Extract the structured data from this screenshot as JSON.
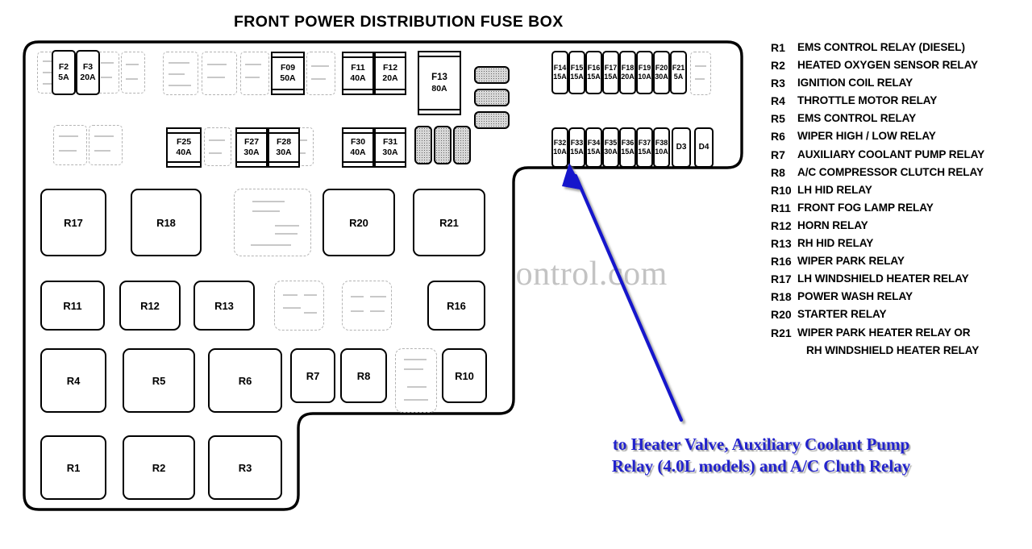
{
  "title": "FRONT POWER DISTRIBUTION FUSE BOX",
  "watermark": "JaguarClimateControl.com",
  "colors": {
    "annotation_blue": "#2222CC",
    "outline_black": "#000000",
    "watermark_grey": "#C3C3C3",
    "shaded_grey": "#D8D8D8"
  },
  "annotation": {
    "line1": "to Heater Valve, Auxiliary Coolant Pump",
    "line2": "Relay (4.0L models) and A/C Cluth Relay",
    "arrow_target": "F33 fuse"
  },
  "fuses": {
    "left_top": [
      {
        "id": "F2",
        "amp": "5A"
      },
      {
        "id": "F3",
        "amp": "20A"
      }
    ],
    "row1": [
      {
        "id": "F09",
        "amp": "50A"
      },
      {
        "id": "F11",
        "amp": "40A"
      },
      {
        "id": "F12",
        "amp": "20A"
      },
      {
        "id": "F13",
        "amp": "80A"
      }
    ],
    "row2": [
      {
        "id": "F25",
        "amp": "40A"
      },
      {
        "id": "F27",
        "amp": "30A"
      },
      {
        "id": "F28",
        "amp": "30A"
      },
      {
        "id": "F30",
        "amp": "40A"
      },
      {
        "id": "F31",
        "amp": "30A"
      }
    ],
    "right_top_strip": [
      {
        "id": "F14",
        "amp": "15A"
      },
      {
        "id": "F15",
        "amp": "15A"
      },
      {
        "id": "F16",
        "amp": "15A"
      },
      {
        "id": "F17",
        "amp": "15A"
      },
      {
        "id": "F18",
        "amp": "20A"
      },
      {
        "id": "F19",
        "amp": "10A"
      },
      {
        "id": "F20",
        "amp": "30A"
      },
      {
        "id": "F21",
        "amp": "5A"
      }
    ],
    "right_bottom_strip": [
      {
        "id": "F32",
        "amp": "10A"
      },
      {
        "id": "F33",
        "amp": "15A"
      },
      {
        "id": "F34",
        "amp": "15A"
      },
      {
        "id": "F35",
        "amp": "30A"
      },
      {
        "id": "F36",
        "amp": "15A"
      },
      {
        "id": "F37",
        "amp": "15A"
      },
      {
        "id": "F38",
        "amp": "10A"
      },
      {
        "id": "D3",
        "amp": ""
      },
      {
        "id": "D4",
        "amp": ""
      }
    ]
  },
  "relays": {
    "row_a": [
      "R17",
      "R18",
      "R20",
      "R21"
    ],
    "row_b": [
      "R11",
      "R12",
      "R13",
      "R16"
    ],
    "row_c": [
      "R4",
      "R5",
      "R6",
      "R7",
      "R8",
      "R10"
    ],
    "row_d": [
      "R1",
      "R2",
      "R3"
    ]
  },
  "legend": [
    {
      "id": "R1",
      "desc": "EMS CONTROL RELAY (DIESEL)"
    },
    {
      "id": "R2",
      "desc": "HEATED OXYGEN SENSOR RELAY"
    },
    {
      "id": "R3",
      "desc": "IGNITION COIL RELAY"
    },
    {
      "id": "R4",
      "desc": "THROTTLE MOTOR RELAY"
    },
    {
      "id": "R5",
      "desc": "EMS CONTROL RELAY"
    },
    {
      "id": "R6",
      "desc": "WIPER HIGH / LOW RELAY"
    },
    {
      "id": "R7",
      "desc": " AUXILIARY COOLANT PUMP RELAY"
    },
    {
      "id": "R8",
      "desc": "A/C COMPRESSOR CLUTCH RELAY"
    },
    {
      "id": "R10",
      "desc": "LH HID RELAY"
    },
    {
      "id": "R11",
      "desc": "FRONT FOG LAMP RELAY"
    },
    {
      "id": "R12",
      "desc": "HORN RELAY"
    },
    {
      "id": "R13",
      "desc": "RH HID RELAY"
    },
    {
      "id": "R16",
      "desc": "WIPER PARK RELAY"
    },
    {
      "id": "R17",
      "desc": "LH WINDSHIELD HEATER RELAY"
    },
    {
      "id": "R18",
      "desc": "POWER WASH RELAY"
    },
    {
      "id": "R20",
      "desc": "STARTER RELAY"
    },
    {
      "id": "R21",
      "desc": "WIPER PARK HEATER RELAY OR"
    },
    {
      "id": "",
      "desc": "RH WINDSHIELD HEATER RELAY",
      "continuation": true
    }
  ]
}
